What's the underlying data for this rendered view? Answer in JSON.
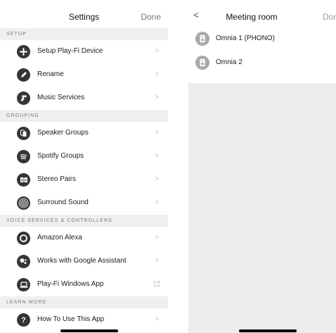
{
  "settings": {
    "title": "Settings",
    "done_label": "Done",
    "sections": {
      "setup": "SETUP",
      "grouping": "GROUPING",
      "voice": "VOICE SERVICES & CONTROLLERS",
      "learn": "LEARN MORE"
    },
    "items": {
      "setup_device": "Setup Play-Fi Device",
      "rename": "Rename",
      "music_services": "Music Services",
      "speaker_groups": "Speaker Groups",
      "spotify_groups": "Spotify Groups",
      "stereo_pairs": "Stereo Pairs",
      "surround_sound": "Surround Sound",
      "amazon_alexa": "Amazon Alexa",
      "google_assistant": "Works with Google Assistant",
      "windows_app": "Play-Fi Windows App",
      "how_to_use": "How To Use This App"
    },
    "chevron": ">"
  },
  "meeting_room": {
    "back": "<",
    "title": "Meeting room",
    "done_label": "Done",
    "devices": [
      "Omnia 1 (PHONO)",
      "Omnia 2"
    ]
  },
  "colors": {
    "icon_dark": "#353535",
    "section_bg": "#efefef",
    "speaker_icon_bg": "#a9a9a9",
    "right_bg": "#ececec"
  }
}
